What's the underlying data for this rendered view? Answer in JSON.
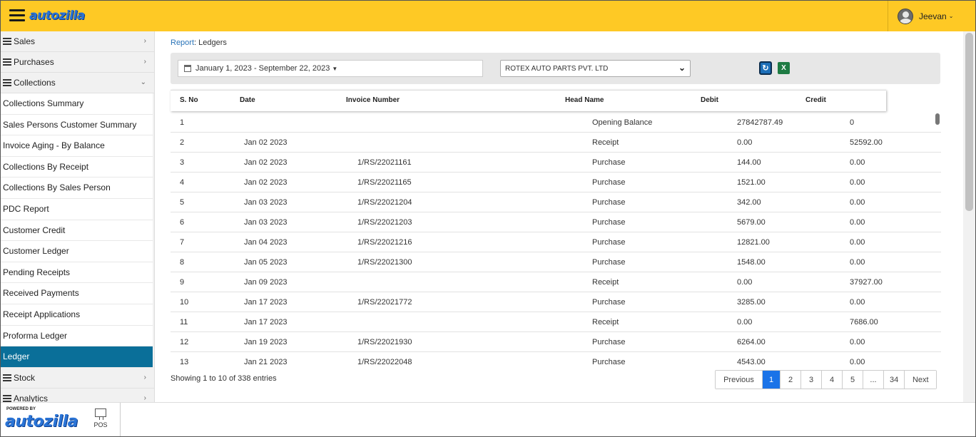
{
  "header": {
    "logo": "autozilla",
    "user_name": "Jeevan"
  },
  "sidebar": {
    "groups_top": [
      {
        "label": "Sales"
      },
      {
        "label": "Purchases"
      },
      {
        "label": "Collections"
      }
    ],
    "items": [
      {
        "label": "Collections Summary"
      },
      {
        "label": "Sales Persons Customer Summary"
      },
      {
        "label": "Invoice Aging - By Balance"
      },
      {
        "label": "Collections By Receipt"
      },
      {
        "label": "Collections By Sales Person"
      },
      {
        "label": "PDC Report"
      },
      {
        "label": "Customer Credit"
      },
      {
        "label": "Customer Ledger"
      },
      {
        "label": "Pending Receipts"
      },
      {
        "label": "Received Payments"
      },
      {
        "label": "Receipt Applications"
      },
      {
        "label": "Proforma Ledger"
      },
      {
        "label": "Ledger"
      }
    ],
    "groups_bottom": [
      {
        "label": "Stock"
      },
      {
        "label": "Analytics"
      }
    ]
  },
  "breadcrumb": {
    "link": "Report",
    "current": ": Ledgers"
  },
  "filters": {
    "date_range": "January 1, 2023 - September 22, 2023",
    "supplier": "ROTEX AUTO PARTS PVT. LTD"
  },
  "table": {
    "columns": [
      "S. No",
      "Date",
      "Invoice Number",
      "Head Name",
      "Debit",
      "Credit"
    ],
    "rows": [
      [
        "1",
        "",
        "",
        "Opening Balance",
        "27842787.49",
        "0"
      ],
      [
        "2",
        "Jan 02 2023",
        "",
        "Receipt",
        "0.00",
        "52592.00"
      ],
      [
        "3",
        "Jan 02 2023",
        "1/RS/22021161",
        "Purchase",
        "144.00",
        "0.00"
      ],
      [
        "4",
        "Jan 02 2023",
        "1/RS/22021165",
        "Purchase",
        "1521.00",
        "0.00"
      ],
      [
        "5",
        "Jan 03 2023",
        "1/RS/22021204",
        "Purchase",
        "342.00",
        "0.00"
      ],
      [
        "6",
        "Jan 03 2023",
        "1/RS/22021203",
        "Purchase",
        "5679.00",
        "0.00"
      ],
      [
        "7",
        "Jan 04 2023",
        "1/RS/22021216",
        "Purchase",
        "12821.00",
        "0.00"
      ],
      [
        "8",
        "Jan 05 2023",
        "1/RS/22021300",
        "Purchase",
        "1548.00",
        "0.00"
      ],
      [
        "9",
        "Jan 09 2023",
        "",
        "Receipt",
        "0.00",
        "37927.00"
      ],
      [
        "10",
        "Jan 17 2023",
        "1/RS/22021772",
        "Purchase",
        "3285.00",
        "0.00"
      ],
      [
        "11",
        "Jan 17 2023",
        "",
        "Receipt",
        "0.00",
        "7686.00"
      ],
      [
        "12",
        "Jan 19 2023",
        "1/RS/22021930",
        "Purchase",
        "6264.00",
        "0.00"
      ],
      [
        "13",
        "Jan 21 2023",
        "1/RS/22022048",
        "Purchase",
        "4543.00",
        "0.00"
      ]
    ]
  },
  "showing_text": "Showing 1 to 10 of 338 entries",
  "pagination": {
    "previous": "Previous",
    "pages": [
      "1",
      "2",
      "3",
      "4",
      "5",
      "...",
      "34"
    ],
    "current": "1",
    "next": "Next"
  },
  "footer": {
    "powered_by": "POWERED BY",
    "logo": "autozilla",
    "pos_label": "POS"
  }
}
